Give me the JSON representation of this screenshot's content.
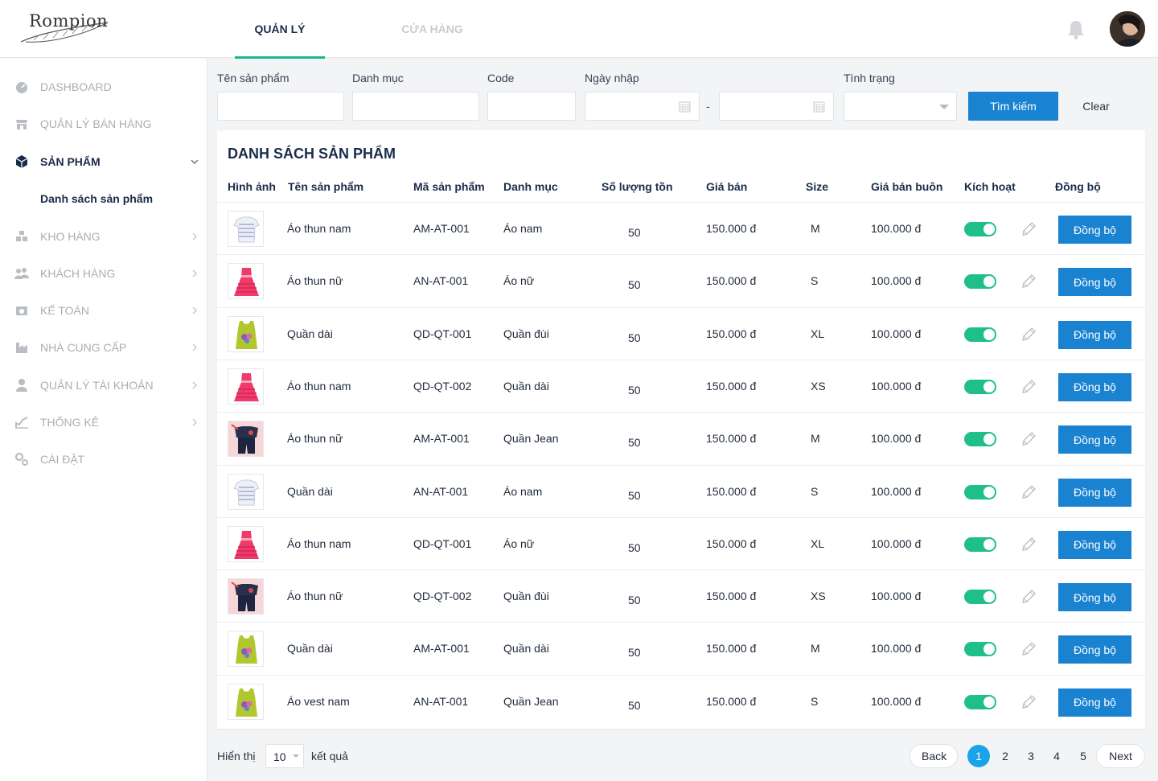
{
  "brand": {
    "logo_text": "Rompion"
  },
  "nav": {
    "tab_manage": "QUẢN LÝ",
    "tab_store": "CỬA HÀNG"
  },
  "sidebar": {
    "items": [
      {
        "label": "DASHBOARD",
        "icon": "dashboard-icon"
      },
      {
        "label": "QUẢN LÝ BÁN HÀNG",
        "icon": "store-icon"
      },
      {
        "label": "SẢN PHẨM",
        "icon": "cube-icon"
      },
      {
        "label": "KHO HÀNG",
        "icon": "warehouse-icon"
      },
      {
        "label": "KHÁCH HÀNG",
        "icon": "users-icon"
      },
      {
        "label": "KẾ TOÁN",
        "icon": "accounting-icon"
      },
      {
        "label": "NHÀ CUNG CẤP",
        "icon": "supplier-icon"
      },
      {
        "label": "QUẢN LÝ TÀI KHOẢN",
        "icon": "account-icon"
      },
      {
        "label": "THỐNG KÊ",
        "icon": "chart-icon"
      },
      {
        "label": "CÀI ĐẶT",
        "icon": "settings-icon"
      }
    ],
    "sub_item": "Danh sách sản phẩm"
  },
  "filters": {
    "product_name": "Tên sản phẩm",
    "category": "Danh mục",
    "code": "Code",
    "import_date": "Ngày nhập",
    "date_separator": "-",
    "status": "Tình trạng",
    "search_button": "Tìm kiếm",
    "clear_button": "Clear"
  },
  "table": {
    "title": "DANH SÁCH SẢN PHẨM",
    "headers": [
      "Hình ảnh",
      "Tên sản phẩm",
      "Mã sản phẩm",
      "Danh mục",
      "Số lượng tồn",
      "Giá bán",
      "Size",
      "Giá bán buôn",
      "Kích hoạt",
      "Đồng bộ"
    ],
    "sync_label": "Đồng bộ",
    "rows": [
      {
        "image": "shirt-white",
        "name": "Áo thun nam",
        "code": "AM-AT-001",
        "category": "Áo nam",
        "qty": "50",
        "price": "150.000 đ",
        "size": "M",
        "wholesale": "100.000 đ",
        "active": true
      },
      {
        "image": "dress-pink",
        "name": "Áo thun nữ",
        "code": "AN-AT-001",
        "category": "Áo nữ",
        "qty": "50",
        "price": "150.000 đ",
        "size": "S",
        "wholesale": "100.000 đ",
        "active": true
      },
      {
        "image": "tank-green",
        "name": "Quần dài",
        "code": "QD-QT-001",
        "category": "Quần đùi",
        "qty": "50",
        "price": "150.000 đ",
        "size": "XL",
        "wholesale": "100.000 đ",
        "active": true
      },
      {
        "image": "dress-pink",
        "name": "Áo thun nam",
        "code": "QD-QT-002",
        "category": "Quần dài",
        "qty": "50",
        "price": "150.000 đ",
        "size": "XS",
        "wholesale": "100.000 đ",
        "active": true
      },
      {
        "image": "outfit-navy",
        "name": "Áo thun nữ",
        "code": "AM-AT-001",
        "category": "Quần Jean",
        "qty": "50",
        "price": "150.000 đ",
        "size": "M",
        "wholesale": "100.000 đ",
        "active": true
      },
      {
        "image": "shirt-white",
        "name": "Quần dài",
        "code": "AN-AT-001",
        "category": "Áo nam",
        "qty": "50",
        "price": "150.000 đ",
        "size": "S",
        "wholesale": "100.000 đ",
        "active": true
      },
      {
        "image": "dress-pink",
        "name": "Áo thun nam",
        "code": "QD-QT-001",
        "category": "Áo nữ",
        "qty": "50",
        "price": "150.000 đ",
        "size": "XL",
        "wholesale": "100.000 đ",
        "active": true
      },
      {
        "image": "outfit-navy",
        "name": "Áo thun nữ",
        "code": "QD-QT-002",
        "category": "Quần đùi",
        "qty": "50",
        "price": "150.000 đ",
        "size": "XS",
        "wholesale": "100.000 đ",
        "active": true
      },
      {
        "image": "tank-green",
        "name": "Quần dài",
        "code": "AM-AT-001",
        "category": "Quần dài",
        "qty": "50",
        "price": "150.000 đ",
        "size": "M",
        "wholesale": "100.000 đ",
        "active": true
      },
      {
        "image": "tank-green",
        "name": "Áo vest nam",
        "code": "AN-AT-001",
        "category": "Quần Jean",
        "qty": "50",
        "price": "150.000 đ",
        "size": "S",
        "wholesale": "100.000 đ",
        "active": true
      }
    ]
  },
  "footer": {
    "show_label": "Hiển thị",
    "page_size": "10",
    "result_label": "kết quả",
    "back": "Back",
    "next": "Next",
    "pages": [
      "1",
      "2",
      "3",
      "4",
      "5"
    ],
    "current_page": "1"
  },
  "colors": {
    "accent": "#1982d1",
    "tab_underline": "#17b890",
    "toggle_on": "#1fbf8a",
    "page_current": "#1aa3e8"
  }
}
